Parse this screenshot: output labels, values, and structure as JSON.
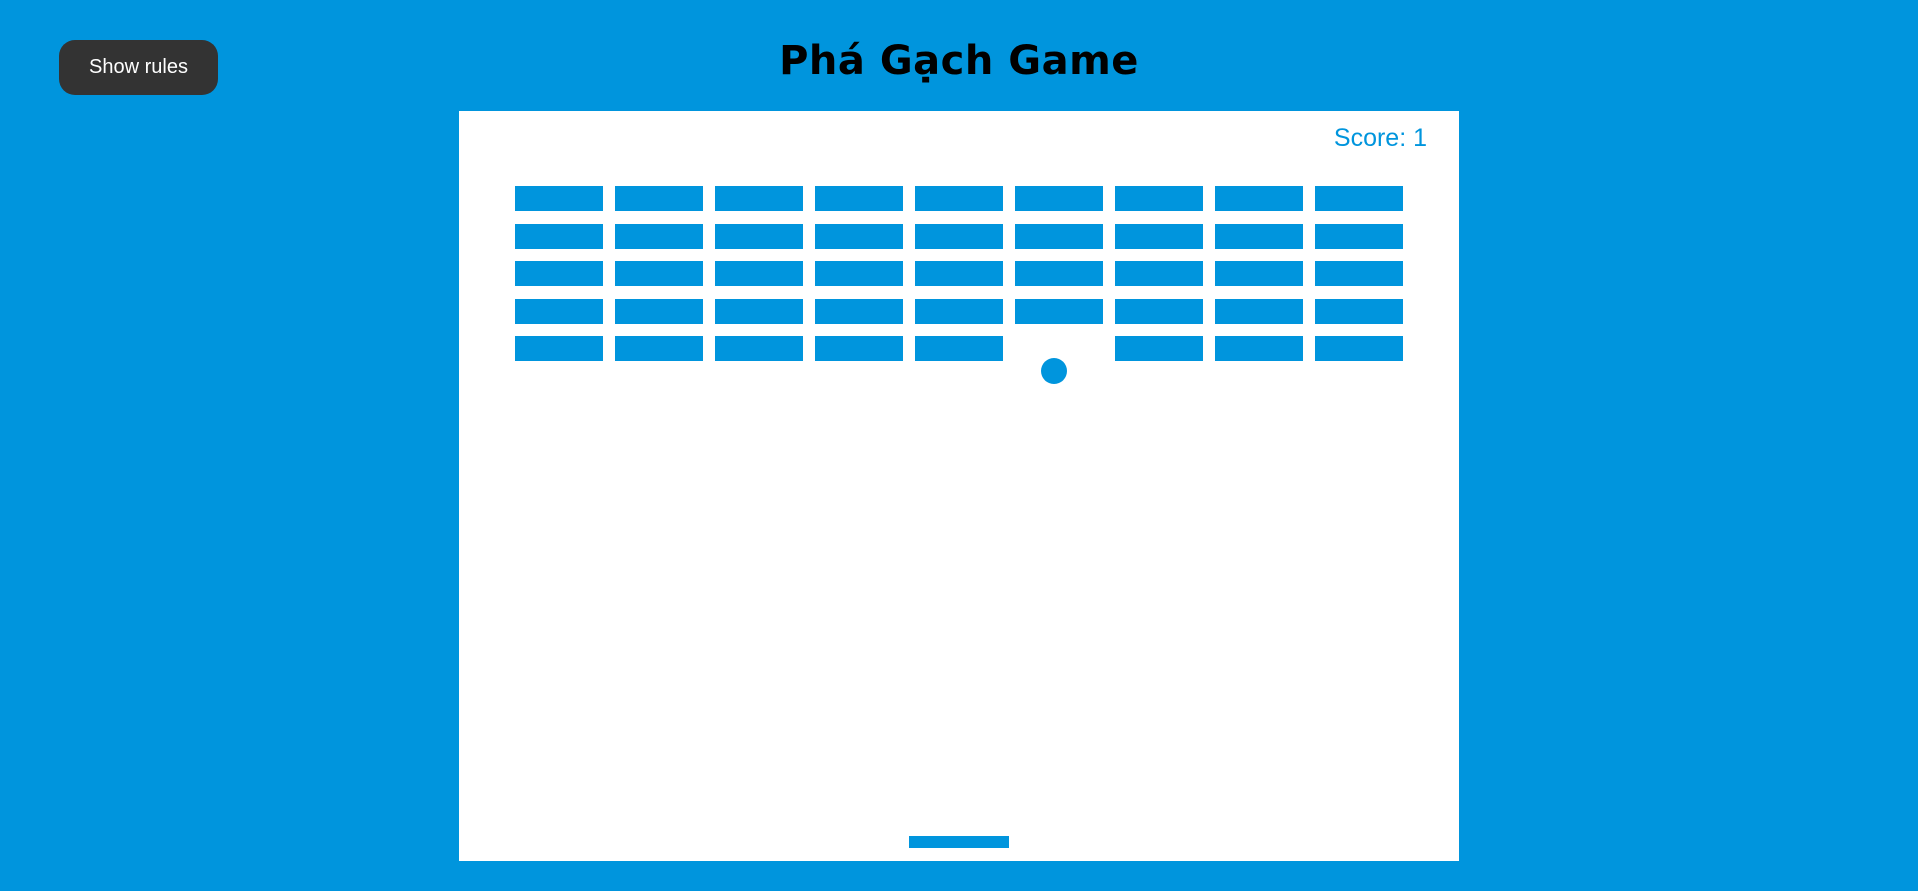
{
  "header": {
    "rules_button_label": "Show rules",
    "title": "Phá Gạch Game"
  },
  "game": {
    "score_text": "Score: 1",
    "score": 1,
    "brick_grid": {
      "rows": 5,
      "columns": 9,
      "missing": [
        {
          "row": 5,
          "column": 6
        }
      ]
    },
    "colors": {
      "background": "#0095dd",
      "board": "#ffffff",
      "brick": "#0095dd",
      "ball": "#0095dd",
      "paddle": "#0095dd",
      "score_text": "#0095dd",
      "button": "#333333"
    }
  }
}
